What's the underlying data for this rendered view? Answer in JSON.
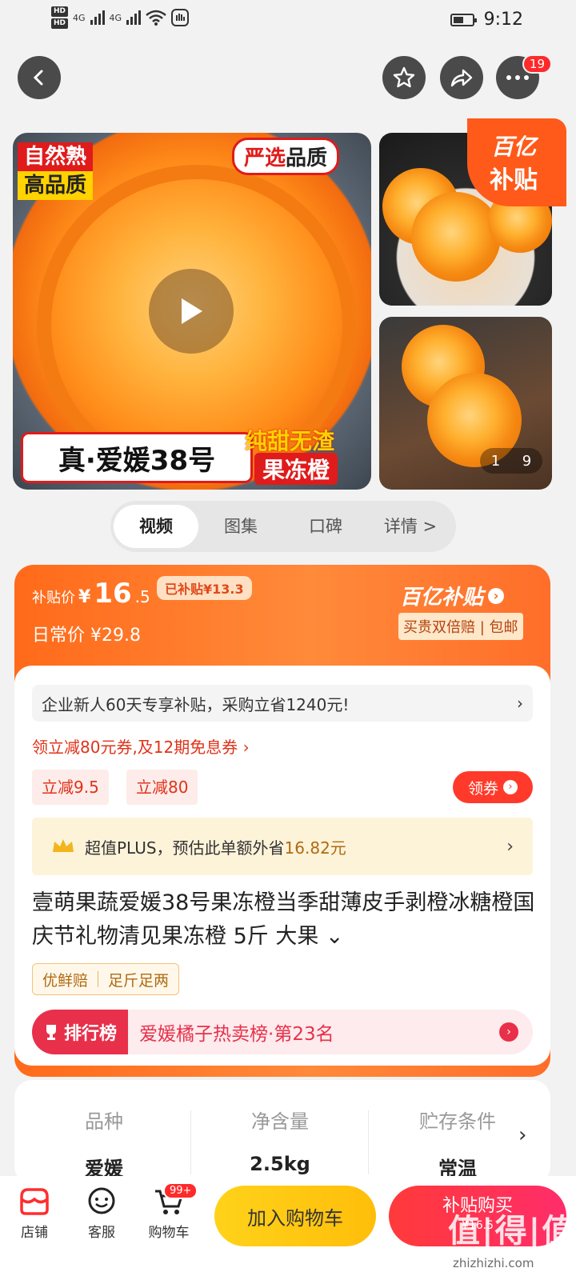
{
  "status_bar": {
    "hd1": "HD",
    "hd2": "HD",
    "net1": "4G",
    "net2": "4G",
    "time": "9:12"
  },
  "nav": {
    "back_icon": "chevron-left-icon",
    "fav_icon": "star-icon",
    "share_icon": "share-icon",
    "more_icon": "more-icon",
    "more_badge": "19"
  },
  "gallery": {
    "tag_natural": "自然熟",
    "tag_quality": "高品质",
    "tag_selected_a": "严选",
    "tag_selected_b": "品质",
    "main_title": "真·爱媛38号",
    "tag_sweet": "纯甜无渣",
    "tag_jelly": "果冻橙",
    "subsidy_badge_l1": "百亿",
    "subsidy_badge_l2": "补贴",
    "pager_current": "1",
    "pager_total": "9"
  },
  "tabs": [
    {
      "label": "视频",
      "active": true
    },
    {
      "label": "图集",
      "active": false
    },
    {
      "label": "口碑",
      "active": false
    },
    {
      "label": "详情 >",
      "active": false
    }
  ],
  "price": {
    "subsidy_label": "补贴价",
    "currency": "¥",
    "subsidy_int": "16",
    "subsidy_dec": ".5",
    "subsidized_tag": "已补贴¥13.3",
    "daily_label": "日常价",
    "daily_price": "¥29.8",
    "brand": "百亿补贴",
    "guarantee": "买贵双倍赔 | 包邮"
  },
  "promo": {
    "enterprise": "企业新人60天专享补贴，采购立省1240元!",
    "coupon_link": "领立减80元券,及12期免息券 ›",
    "chip1": "立减9.5",
    "chip2": "立减80",
    "get_coupon": "领券",
    "plus_text_a": "超值PLUS，预估此单额外省",
    "plus_text_b": "16.82元"
  },
  "product": {
    "title": "壹萌果蔬爱媛38号果冻橙当季甜薄皮手剥橙冰糖橙国庆节礼物清见果冻橙 5斤 大果 ⌄",
    "tag1": "优鲜赔",
    "tag2": "足斤足两",
    "rank_badge": "排行榜",
    "rank_text": "爱媛橘子热卖榜·第23名"
  },
  "attributes": [
    {
      "key": "品种",
      "value": "爱媛"
    },
    {
      "key": "净含量",
      "value": "2.5kg"
    },
    {
      "key": "贮存条件",
      "value": "常温"
    }
  ],
  "bottom": {
    "store": "店铺",
    "service": "客服",
    "cart": "购物车",
    "cart_badge": "99+",
    "add_cart": "加入购物车",
    "buy": "补贴购买",
    "buy_price": "¥16.5",
    "watermark": "值|得|值",
    "watermark_url": "zhizhizhi.com"
  }
}
